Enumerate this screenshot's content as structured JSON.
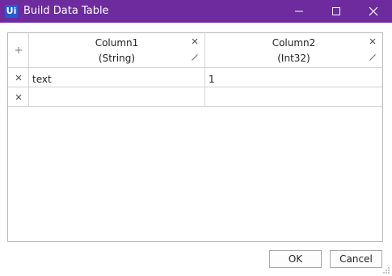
{
  "window": {
    "logo_text": "Ui",
    "title": "Build Data Table",
    "minimize_icon": "minimize-icon",
    "maximize_icon": "maximize-icon",
    "close_icon": "close-icon"
  },
  "table": {
    "columns": [
      {
        "name": "Column1",
        "type": "(String)"
      },
      {
        "name": "Column2",
        "type": "(Int32)"
      }
    ],
    "rows": [
      [
        "text",
        "1"
      ],
      [
        "",
        ""
      ]
    ],
    "icons": {
      "add": "plus-icon",
      "delete": "x-icon",
      "edit": "pencil-icon"
    }
  },
  "buttons": {
    "ok": "OK",
    "cancel": "Cancel"
  }
}
